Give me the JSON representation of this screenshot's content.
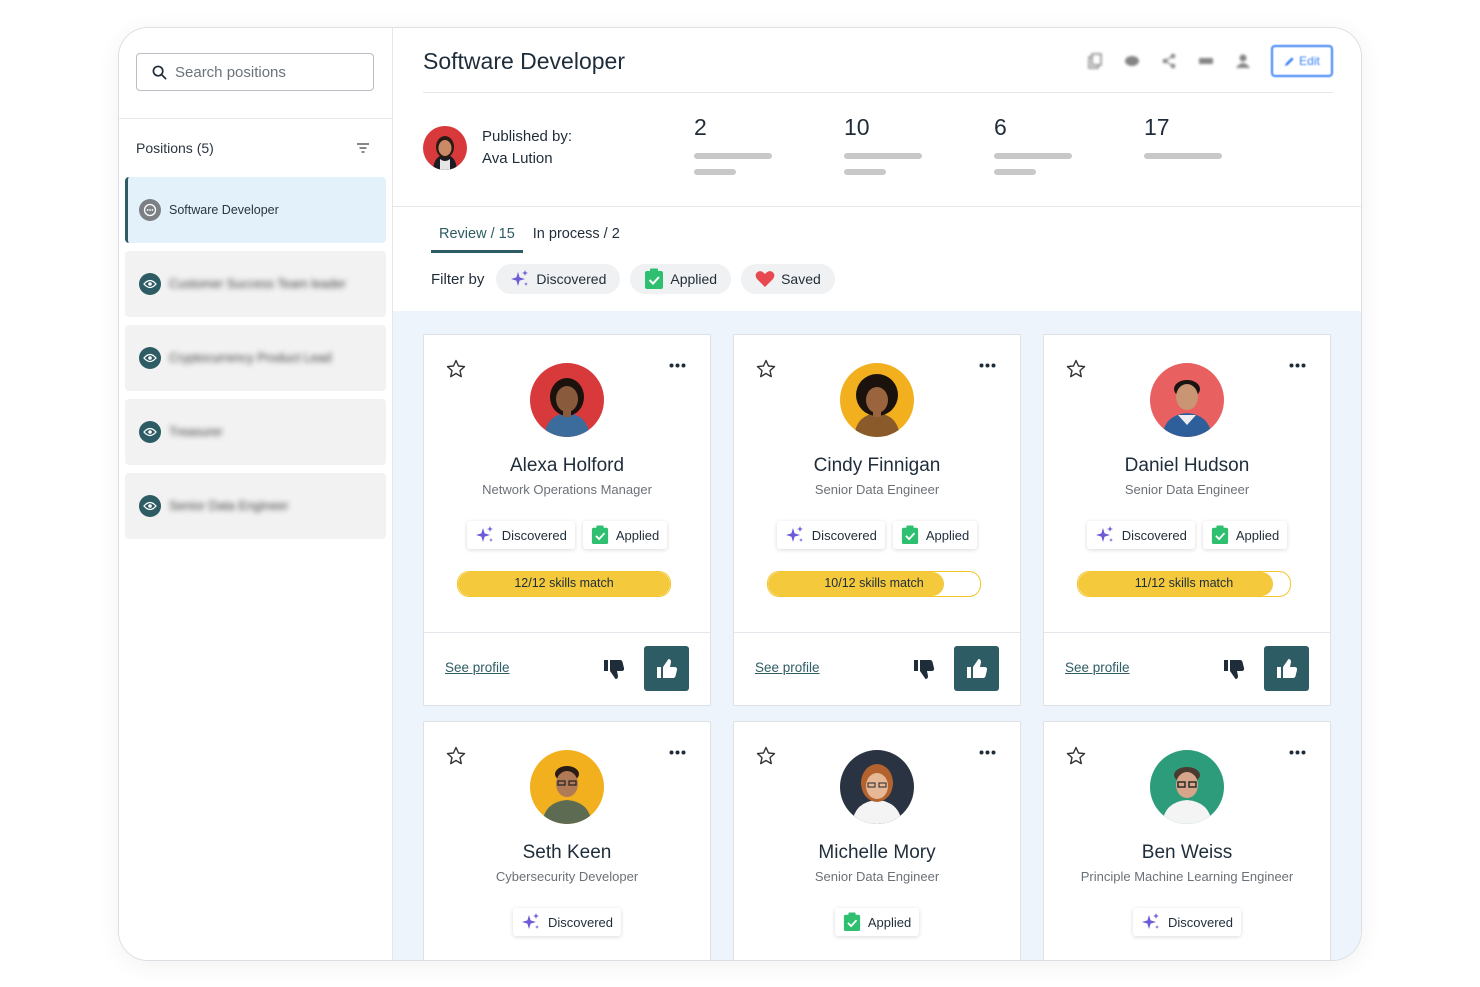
{
  "search": {
    "placeholder": "Search positions"
  },
  "sidebar": {
    "header": "Positions (5)",
    "items": [
      {
        "label": "Software Developer"
      },
      {
        "label": "Customer Success Team leader"
      },
      {
        "label": "Cryptocurrency Product Lead"
      },
      {
        "label": "Treasurer"
      },
      {
        "label": "Senior Data Engineer"
      }
    ]
  },
  "header": {
    "title": "Software Developer",
    "edit_label": "Edit"
  },
  "publisher": {
    "line1": "Published by:",
    "name": "Ava Lution"
  },
  "stats": [
    "2",
    "10",
    "6",
    "17"
  ],
  "tabs": [
    {
      "label": "Review / 15"
    },
    {
      "label": "In process / 2"
    }
  ],
  "filter": {
    "label": "Filter by",
    "chips": [
      "Discovered",
      "Applied",
      "Saved"
    ]
  },
  "candidates": [
    {
      "name": "Alexa Holford",
      "role": "Network Operations Manager",
      "tags": [
        "Discovered",
        "Applied"
      ],
      "skills": "12/12 skills match",
      "match": 1.0,
      "see": "See profile"
    },
    {
      "name": "Cindy Finnigan",
      "role": "Senior Data Engineer",
      "tags": [
        "Discovered",
        "Applied"
      ],
      "skills": "10/12 skills match",
      "match": 0.83,
      "see": "See profile"
    },
    {
      "name": "Daniel Hudson",
      "role": "Senior Data Engineer",
      "tags": [
        "Discovered",
        "Applied"
      ],
      "skills": "11/12 skills match",
      "match": 0.92,
      "see": "See profile"
    },
    {
      "name": "Seth Keen",
      "role": "Cybersecurity Developer",
      "tags": [
        "Discovered"
      ]
    },
    {
      "name": "Michelle Mory",
      "role": "Senior Data Engineer",
      "tags": [
        "Applied"
      ]
    },
    {
      "name": "Ben Weiss",
      "role": "Principle Machine Learning Engineer",
      "tags": [
        "Discovered"
      ]
    }
  ],
  "colors": {
    "accent": "#2e5c64",
    "skill_bar": "#f4c93b",
    "avatar_bgs": [
      "#d8393b",
      "#f2b01e",
      "#e8605f",
      "#f2b01e",
      "#2a3342",
      "#2d9c7a"
    ]
  }
}
